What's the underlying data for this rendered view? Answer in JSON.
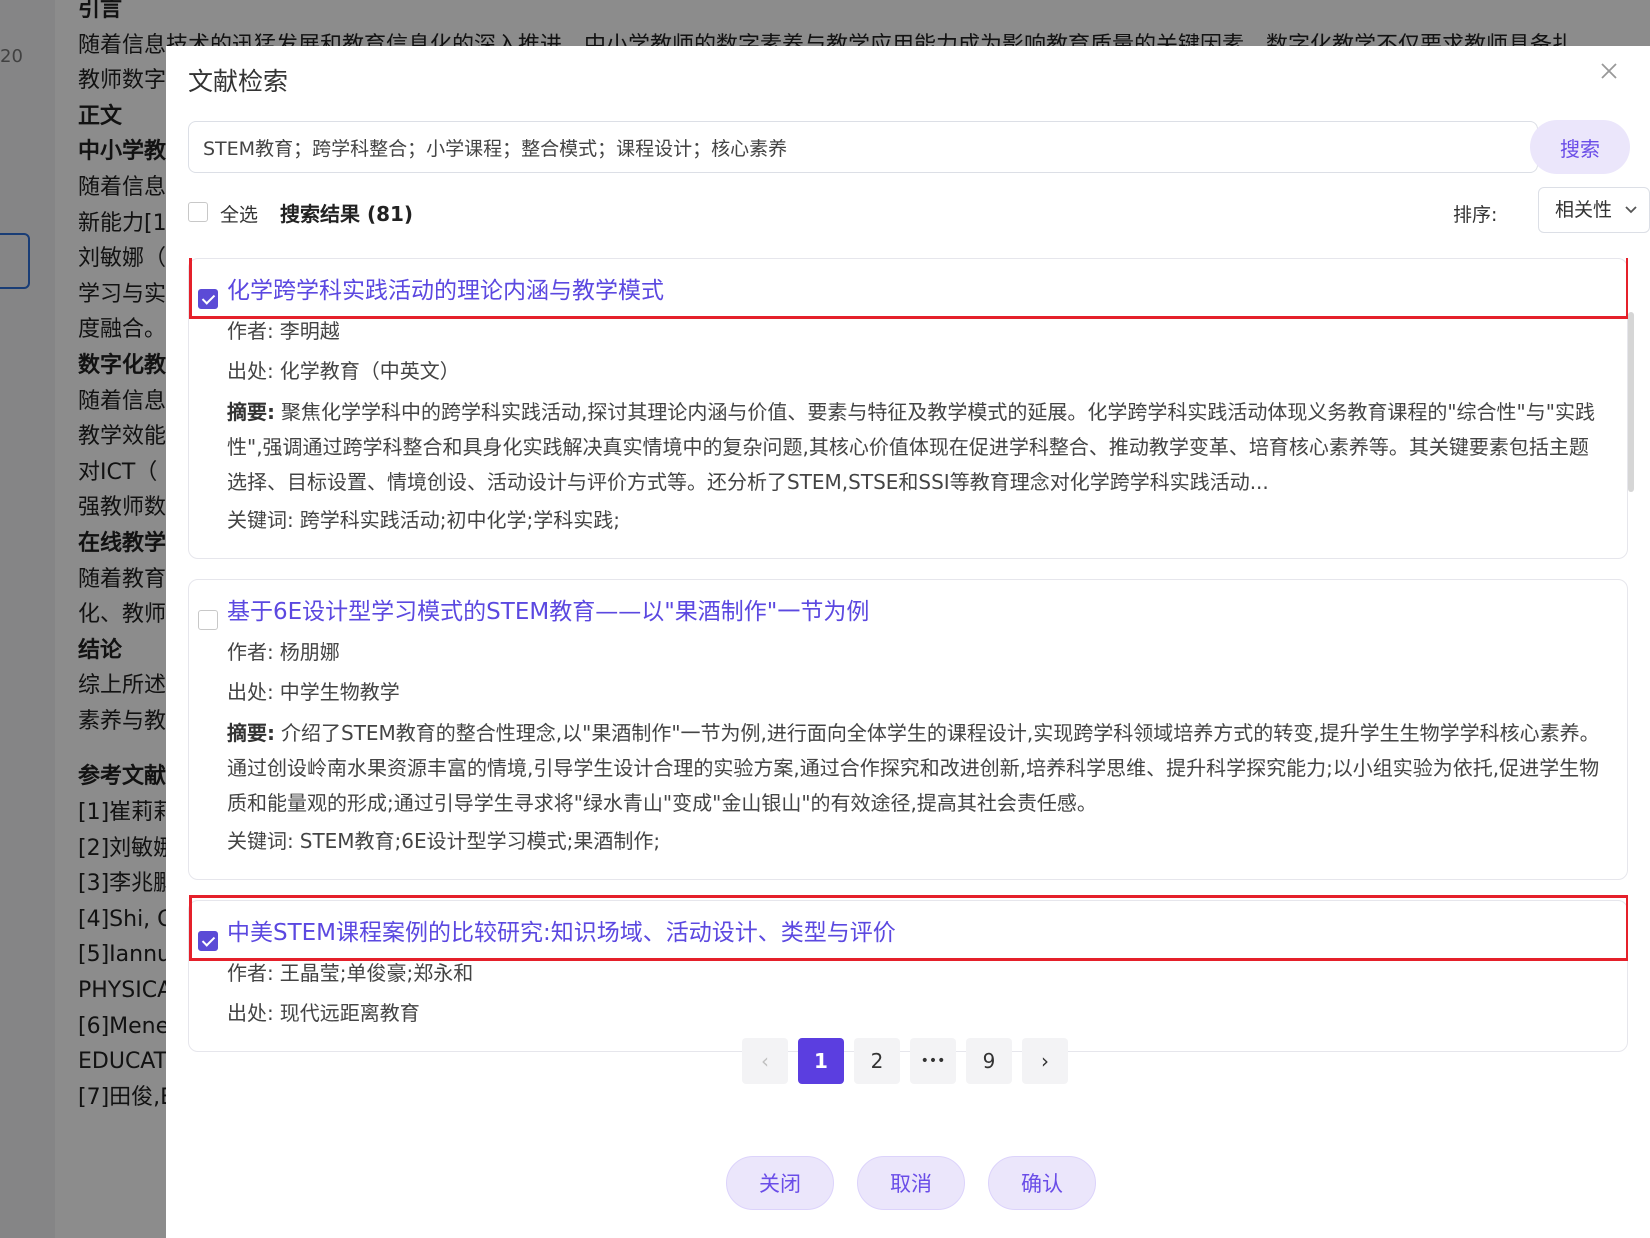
{
  "background": {
    "line_number": "20",
    "lines": [
      {
        "text": "引言",
        "bold": true
      },
      {
        "text": "随着信息技术的迅猛发展和教育信息化的深入推进，中小学教师的数字素养与教学应用能力成为影响教育质量的关键因素。数字化教学不仅要求教师具备扎",
        "bold": false
      },
      {
        "text": "教师数字",
        "bold": false
      },
      {
        "text": "正文",
        "bold": true
      },
      {
        "text": "中小学教",
        "bold": true
      },
      {
        "text": "随着信息",
        "bold": false
      },
      {
        "text": "新能力[1",
        "bold": false
      },
      {
        "text": "刘敏娜（",
        "bold": false
      },
      {
        "text": "学习与实",
        "bold": false
      },
      {
        "text": "度融合。",
        "bold": false
      },
      {
        "text": "数字化教",
        "bold": true
      },
      {
        "text": "随着信息",
        "bold": false
      },
      {
        "text": "教学效能",
        "bold": false
      },
      {
        "text": "对ICT（",
        "bold": false
      },
      {
        "text": "强教师数",
        "bold": false
      },
      {
        "text": "在线教学",
        "bold": true
      },
      {
        "text": "随着教育",
        "bold": false
      },
      {
        "text": "化、教师",
        "bold": false
      },
      {
        "text": "结论",
        "bold": true
      },
      {
        "text": "综上所述",
        "bold": false
      },
      {
        "text": "素养与教",
        "bold": false
      }
    ],
    "refs_title": "参考文献",
    "refs": [
      "[1]崔莉莉",
      "[2]刘敏娜",
      "[3]李兆鹏",
      "[4]Shi, C",
      "[5]Iannu",
      "PHYSICA",
      "[6]Mene",
      "EDUCAT",
      "[7]田俊,E"
    ]
  },
  "dialog": {
    "title": "文献检索",
    "search_value": "STEM教育；跨学科整合；小学课程；整合模式；课程设计；核心素养",
    "search_button": "搜索",
    "select_all": "全选",
    "results_label": "搜索结果 (81)",
    "sort_label": "排序:",
    "sort_value": "相关性",
    "results": [
      {
        "checked": true,
        "highlighted": true,
        "title": "化学跨学科实践活动的理论内涵与教学模式",
        "author_label": "作者:",
        "author": "李明越",
        "source_label": "出处:",
        "source": "化学教育（中英文）",
        "abstract_label": "摘要:",
        "abstract": "聚焦化学学科中的跨学科实践活动,探讨其理论内涵与价值、要素与特征及教学模式的延展。化学跨学科实践活动体现义务教育课程的\"综合性\"与\"实践性\",强调通过跨学科整合和具身化实践解决真实情境中的复杂问题,其核心价值体现在促进学科整合、推动教学变革、培育核心素养等。其关键要素包括主题选择、目标设置、情境创设、活动设计与评价方式等。还分析了STEM,STSE和SSI等教育理念对化学跨学科实践活动...",
        "keywords_label": "关键词:",
        "keywords": "跨学科实践活动;初中化学;学科实践;"
      },
      {
        "checked": false,
        "highlighted": false,
        "title": "基于6E设计型学习模式的STEM教育——以\"果酒制作\"一节为例",
        "author_label": "作者:",
        "author": "杨朋娜",
        "source_label": "出处:",
        "source": "中学生物教学",
        "abstract_label": "摘要:",
        "abstract": "介绍了STEM教育的整合性理念,以\"果酒制作\"一节为例,进行面向全体学生的课程设计,实现跨学科领域培养方式的转变,提升学生生物学学科核心素养。通过创设岭南水果资源丰富的情境,引导学生设计合理的实验方案,通过合作探究和改进创新,培养科学思维、提升科学探究能力;以小组实验为依托,促进学生物质和能量观的形成;通过引导学生寻求将\"绿水青山\"变成\"金山银山\"的有效途径,提高其社会责任感。",
        "keywords_label": "关键词:",
        "keywords": "STEM教育;6E设计型学习模式;果酒制作;"
      },
      {
        "checked": true,
        "highlighted": true,
        "title": "中美STEM课程案例的比较研究:知识场域、活动设计、类型与评价",
        "author_label": "作者:",
        "author": "王晶莹;单俊豪;郑永和",
        "source_label": "出处:",
        "source": "现代远距离教育",
        "abstract_label": "",
        "abstract": "",
        "keywords_label": "",
        "keywords": ""
      }
    ],
    "pagination": {
      "prev": "‹",
      "pages": [
        "1",
        "2",
        "•••",
        "9"
      ],
      "current": "1",
      "next": "›"
    },
    "footer": {
      "close": "关闭",
      "cancel": "取消",
      "confirm": "确认"
    }
  },
  "colors": {
    "accent": "#5b3ee0",
    "link": "#5b48e0",
    "highlight_box": "#e5202a",
    "button_bg": "#ebe6fb"
  },
  "icons": {
    "close": "close-icon",
    "sort_dropdown": "chevron-down-icon",
    "checkbox": "checkbox"
  }
}
